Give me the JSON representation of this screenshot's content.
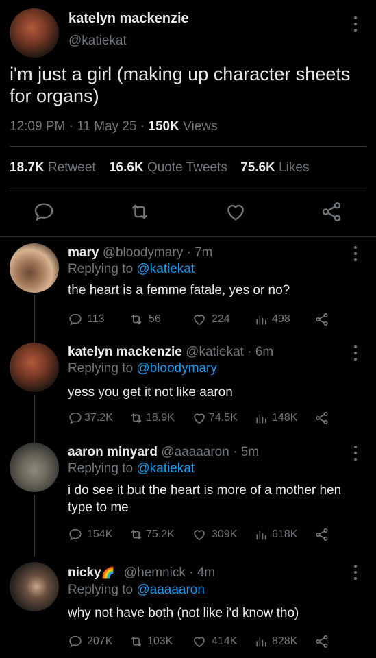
{
  "main_tweet": {
    "name": "katelyn mackenzie",
    "handle": "@katiekat",
    "text": "i'm just a girl (making up character sheets for organs)",
    "time": "12:09 PM",
    "date": "11 May 25",
    "views_count": "150K",
    "views_label": "Views",
    "retweets_count": "18.7K",
    "retweets_label": "Retweet",
    "quotes_count": "16.6K",
    "quotes_label": "Quote Tweets",
    "likes_count": "75.6K",
    "likes_label": "Likes"
  },
  "replies": [
    {
      "name": "mary",
      "handle": "@bloodymary",
      "age": "7m",
      "replying_prefix": "Replying to",
      "replying_to": "@katiekat",
      "text": "the heart is a femme fatale, yes or no?",
      "replies": "113",
      "retweets": "56",
      "likes": "224",
      "views": "498"
    },
    {
      "name": "katelyn mackenzie",
      "handle": "@katiekat",
      "age": "6m",
      "replying_prefix": "Replying to",
      "replying_to": "@bloodymary",
      "text": "yess you get it not like aaron",
      "replies": "37.2K",
      "retweets": "18.9K",
      "likes": "74.5K",
      "views": "148K"
    },
    {
      "name": "aaron minyard",
      "handle": "@aaaaaron",
      "age": "5m",
      "replying_prefix": "Replying to",
      "replying_to": "@katiekat",
      "text": "i do see it but the heart is more of a mother hen type to me",
      "replies": "154K",
      "retweets": "75.2K",
      "likes": "309K",
      "views": "618K"
    },
    {
      "name": "nicky",
      "name_emoji": "🌈",
      "handle": "@hemnick",
      "age": "4m",
      "replying_prefix": "Replying to",
      "replying_to": "@aaaaaron",
      "text": "why not have both (not like i'd know tho)",
      "replies": "207K",
      "retweets": "103K",
      "likes": "414K",
      "views": "828K"
    }
  ],
  "separator": "·",
  "icons": {
    "reply": "speech-bubble-icon",
    "retweet": "retweet-icon",
    "like": "heart-icon",
    "views": "bar-chart-icon",
    "share": "share-icon",
    "more": "more-vertical-icon"
  },
  "colors": {
    "background": "#000000",
    "text": "#e7e9ea",
    "muted": "#71767b",
    "link": "#1d9bf0",
    "divider": "#2f3336"
  }
}
